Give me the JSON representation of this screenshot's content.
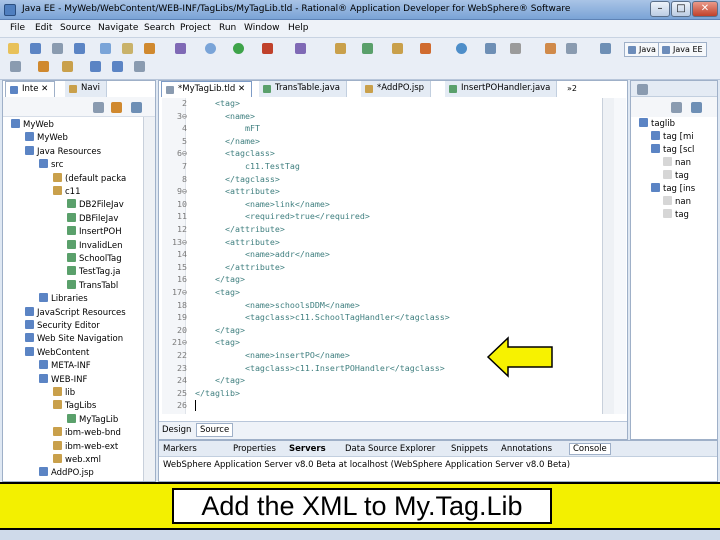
{
  "window": {
    "title": "Java EE - MyWeb/WebContent/WEB-INF/TagLibs/MyTagLib.tld - Rational® Application Developer for WebSphere® Software"
  },
  "menu": [
    "File",
    "Edit",
    "Source",
    "Navigate",
    "Search",
    "Project",
    "Run",
    "Window",
    "Help"
  ],
  "perspectives": [
    "Java",
    "Java EE"
  ],
  "explorer": {
    "tabs": [
      "Inte",
      "Navi"
    ],
    "tree": [
      {
        "label": "MyWeb",
        "depth": 0
      },
      {
        "label": "MyWeb",
        "depth": 1
      },
      {
        "label": "Java Resources",
        "depth": 1
      },
      {
        "label": "src",
        "depth": 2
      },
      {
        "label": "(default packa",
        "depth": 3
      },
      {
        "label": "c11",
        "depth": 3
      },
      {
        "label": "DB2FileJav",
        "depth": 4
      },
      {
        "label": "DBFileJav",
        "depth": 4
      },
      {
        "label": "InsertPOH",
        "depth": 4
      },
      {
        "label": "InvalidLen",
        "depth": 4
      },
      {
        "label": "SchoolTag",
        "depth": 4
      },
      {
        "label": "TestTag.ja",
        "depth": 4
      },
      {
        "label": "TransTabl",
        "depth": 4
      },
      {
        "label": "Libraries",
        "depth": 2
      },
      {
        "label": "JavaScript Resources",
        "depth": 1
      },
      {
        "label": "Security Editor",
        "depth": 1
      },
      {
        "label": "Web Site Navigation",
        "depth": 1
      },
      {
        "label": "WebContent",
        "depth": 1
      },
      {
        "label": "META-INF",
        "depth": 2
      },
      {
        "label": "WEB-INF",
        "depth": 2
      },
      {
        "label": "lib",
        "depth": 3
      },
      {
        "label": "TagLibs",
        "depth": 3
      },
      {
        "label": "MyTagLib",
        "depth": 4
      },
      {
        "label": "ibm-web-bnd",
        "depth": 3
      },
      {
        "label": "ibm-web-ext",
        "depth": 3
      },
      {
        "label": "web.xml",
        "depth": 3
      },
      {
        "label": "AddPO.jsp",
        "depth": 2
      }
    ]
  },
  "editor": {
    "tabs": [
      "*MyTagLib.tld",
      "TransTable.java",
      "*AddPO.jsp",
      "InsertPOHandler.java"
    ],
    "overflow": "»2",
    "lines": [
      {
        "n": "2",
        "t": "    <tag>"
      },
      {
        "n": "3⊖",
        "t": "      <name>"
      },
      {
        "n": "4",
        "t": "          mFT"
      },
      {
        "n": "5",
        "t": "      </name>"
      },
      {
        "n": "6⊖",
        "t": "      <tagclass>"
      },
      {
        "n": "7",
        "t": "          c11.TestTag"
      },
      {
        "n": "8",
        "t": "      </tagclass>"
      },
      {
        "n": "9⊖",
        "t": "      <attribute>"
      },
      {
        "n": "10",
        "t": "          <name>link</name>"
      },
      {
        "n": "11",
        "t": "          <required>true</required>"
      },
      {
        "n": "12",
        "t": "      </attribute>"
      },
      {
        "n": "13⊖",
        "t": "      <attribute>"
      },
      {
        "n": "14",
        "t": "          <name>addr</name>"
      },
      {
        "n": "15",
        "t": "      </attribute>"
      },
      {
        "n": "16",
        "t": "    </tag>"
      },
      {
        "n": "17⊖",
        "t": "    <tag>"
      },
      {
        "n": "18",
        "t": "          <name>schoolsDDM</name>"
      },
      {
        "n": "19",
        "t": "          <tagclass>c11.SchoolTagHandler</tagclass>"
      },
      {
        "n": "20",
        "t": "    </tag>"
      },
      {
        "n": "21⊖",
        "t": "    <tag>"
      },
      {
        "n": "22",
        "t": "          <name>insertPO</name>"
      },
      {
        "n": "23",
        "t": "          <tagclass>c11.InsertPOHandler</tagclass>"
      },
      {
        "n": "24",
        "t": "    </tag>"
      },
      {
        "n": "25",
        "t": "</taglib>"
      },
      {
        "n": "26",
        "t": ""
      }
    ],
    "bottom_tabs": [
      "Design",
      "Source"
    ]
  },
  "outline": {
    "tree": [
      {
        "label": "taglib",
        "depth": 0
      },
      {
        "label": "tag [mi",
        "depth": 1
      },
      {
        "label": "tag [scl",
        "depth": 1
      },
      {
        "label": "nan",
        "depth": 2
      },
      {
        "label": "tag",
        "depth": 2
      },
      {
        "label": "tag [ins",
        "depth": 1
      },
      {
        "label": "nan",
        "depth": 2
      },
      {
        "label": "tag",
        "depth": 2
      }
    ]
  },
  "bottom_panel": {
    "tabs": [
      "Markers",
      "Properties",
      "Servers",
      "Data Source Explorer",
      "Snippets",
      "Annotations",
      "Console"
    ],
    "console_text": "WebSphere Application Server v8.0 Beta at localhost (WebSphere Application Server v8.0 Beta)"
  },
  "callout": {
    "text": "Add the XML to My.Tag.Lib"
  },
  "colors": {
    "callout_bg": "#f3f000",
    "arrow_fill": "#f7f200",
    "tag_color": "#3f7f7f"
  }
}
